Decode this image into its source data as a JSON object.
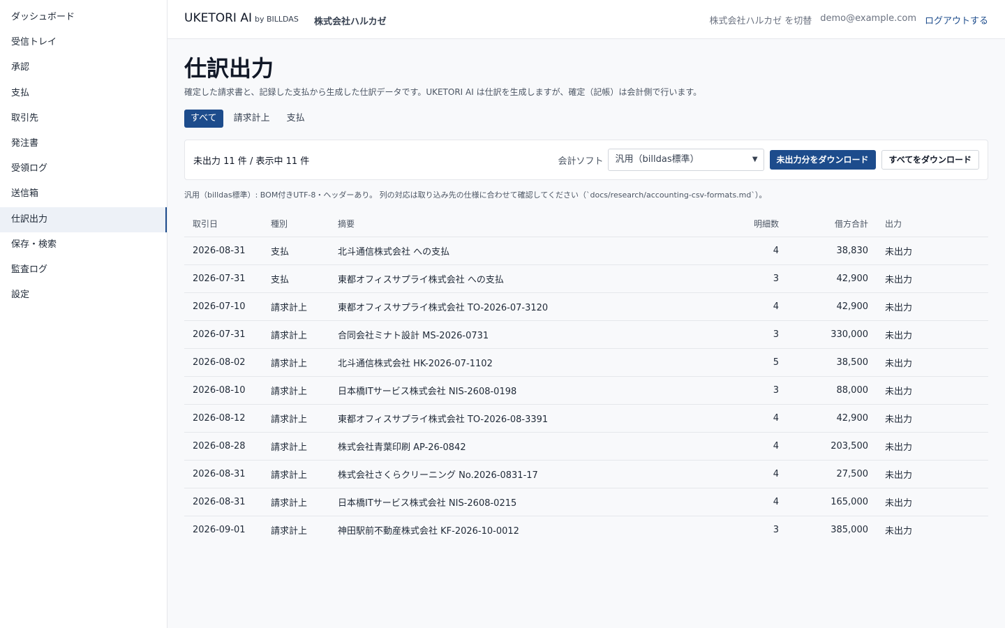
{
  "sidebar": {
    "items": [
      {
        "label": "ダッシュボード"
      },
      {
        "label": "受信トレイ"
      },
      {
        "label": "承認"
      },
      {
        "label": "支払"
      },
      {
        "label": "取引先"
      },
      {
        "label": "発注書"
      },
      {
        "label": "受領ログ"
      },
      {
        "label": "送信箱"
      },
      {
        "label": "仕訳出力"
      },
      {
        "label": "保存・検索"
      },
      {
        "label": "監査ログ"
      },
      {
        "label": "設定"
      }
    ],
    "active_label": "仕訳出力"
  },
  "header": {
    "brand": "UKETORI AI",
    "brand_sub": "by BILLDAS",
    "org": "株式会社ハルカゼ",
    "switch_label": "株式会社ハルカゼ を切替",
    "email": "demo@example.com",
    "logout_label": "ログアウトする"
  },
  "page": {
    "title": "仕訳出力",
    "description": "確定した請求書と、記録した支払から生成した仕訳データです。UKETORI AI は仕訳を生成しますが、確定（記帳）は会計側で行います。"
  },
  "tabs": [
    {
      "label": "すべて"
    },
    {
      "label": "請求計上"
    },
    {
      "label": "支払"
    }
  ],
  "active_tab": "すべて",
  "toolbar": {
    "summary": "未出力 11 件 / 表示中 11 件",
    "software_label": "会計ソフト",
    "selected_software": "汎用（billdas標準）",
    "download_unexported_label": "未出力分をダウンロード",
    "download_all_label": "すべてをダウンロード"
  },
  "format_note": "汎用（billdas標準）: BOM付きUTF-8・ヘッダーあり。 列の対応は取り込み先の仕様に合わせて確認してください（`docs/research/accounting-csv-formats.md`）。",
  "table": {
    "columns": [
      "取引日",
      "種別",
      "摘要",
      "明細数",
      "借方合計",
      "出力"
    ],
    "rows": [
      [
        "2026-08-31",
        "支払",
        "北斗通信株式会社 への支払",
        "4",
        "38,830",
        "未出力"
      ],
      [
        "2026-07-31",
        "支払",
        "東都オフィスサプライ株式会社 への支払",
        "3",
        "42,900",
        "未出力"
      ],
      [
        "2026-07-10",
        "請求計上",
        "東都オフィスサプライ株式会社 TO-2026-07-3120",
        "4",
        "42,900",
        "未出力"
      ],
      [
        "2026-07-31",
        "請求計上",
        "合同会社ミナト設計 MS-2026-0731",
        "3",
        "330,000",
        "未出力"
      ],
      [
        "2026-08-02",
        "請求計上",
        "北斗通信株式会社 HK-2026-07-1102",
        "5",
        "38,500",
        "未出力"
      ],
      [
        "2026-08-10",
        "請求計上",
        "日本橋ITサービス株式会社 NIS-2608-0198",
        "3",
        "88,000",
        "未出力"
      ],
      [
        "2026-08-12",
        "請求計上",
        "東都オフィスサプライ株式会社 TO-2026-08-3391",
        "4",
        "42,900",
        "未出力"
      ],
      [
        "2026-08-28",
        "請求計上",
        "株式会社青葉印刷 AP-26-0842",
        "4",
        "203,500",
        "未出力"
      ],
      [
        "2026-08-31",
        "請求計上",
        "株式会社さくらクリーニング No.2026-0831-17",
        "4",
        "27,500",
        "未出力"
      ],
      [
        "2026-08-31",
        "請求計上",
        "日本橋ITサービス株式会社 NIS-2608-0215",
        "4",
        "165,000",
        "未出力"
      ],
      [
        "2026-09-01",
        "請求計上",
        "神田駅前不動産株式会社 KF-2026-10-0012",
        "3",
        "385,000",
        "未出力"
      ]
    ]
  },
  "colors": {
    "accent": "#1d4c8c",
    "active_nav_bg": "#edf1f7"
  }
}
